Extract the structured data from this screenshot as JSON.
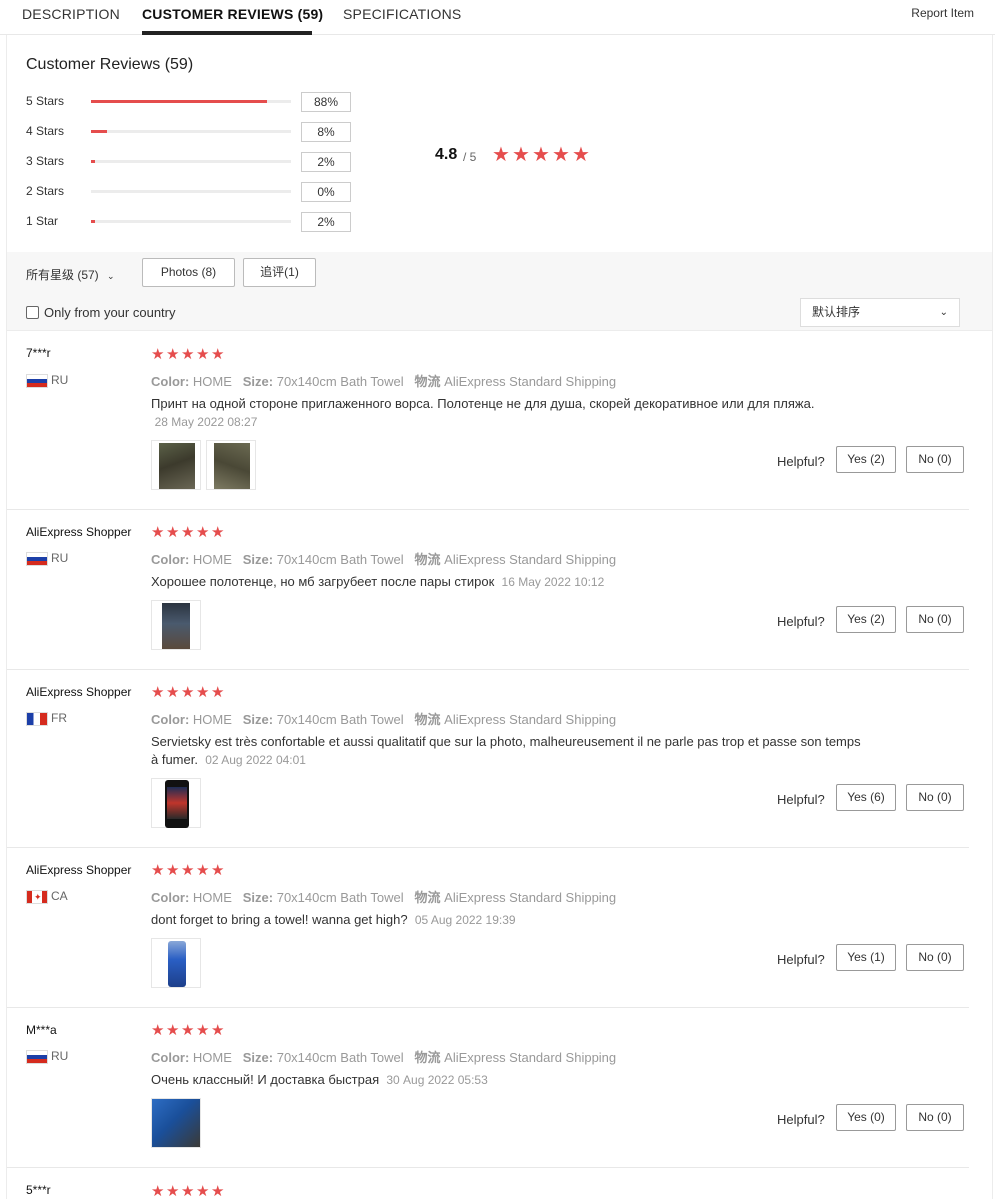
{
  "tabs": [
    {
      "label": "DESCRIPTION"
    },
    {
      "label": "CUSTOMER REVIEWS (59)",
      "active": true
    },
    {
      "label": "SPECIFICATIONS"
    }
  ],
  "report_item": "Report Item",
  "summary": {
    "title": "Customer Reviews (59)",
    "distribution": [
      {
        "label": "5 Stars",
        "percent": 88,
        "percent_label": "88%"
      },
      {
        "label": "4 Stars",
        "percent": 8,
        "percent_label": "8%"
      },
      {
        "label": "3 Stars",
        "percent": 2,
        "percent_label": "2%"
      },
      {
        "label": "2 Stars",
        "percent": 0,
        "percent_label": "0%"
      },
      {
        "label": "1 Star",
        "percent": 2,
        "percent_label": "2%"
      }
    ],
    "average": "4.8",
    "average_of": "/ 5",
    "average_stars": 5
  },
  "filters": {
    "all_stars": "所有星级 (57)",
    "photos": "Photos (8)",
    "followup": "追评(1)",
    "only_country": "Only from your country",
    "sort": "默认排序"
  },
  "colors": {
    "accent": "#e54d4d"
  },
  "reviews": [
    {
      "user": "7***r",
      "country": "RU",
      "stars": 5,
      "color_label": "Color:",
      "color": "HOME",
      "size_label": "Size:",
      "size": "70x140cm Bath Towel",
      "ship_label": "物流",
      "shipping": "AliExpress Standard Shipping",
      "text": "Принт на одной стороне приглаженного ворса. Полотенце не для душа, скорей декоративное или для пляжа.",
      "date": "28 May 2022 08:27",
      "helpful": "Helpful?",
      "yes": "Yes (2)",
      "no": "No (0)"
    },
    {
      "user": "AliExpress Shopper",
      "country": "RU",
      "stars": 5,
      "color_label": "Color:",
      "color": "HOME",
      "size_label": "Size:",
      "size": "70x140cm Bath Towel",
      "ship_label": "物流",
      "shipping": "AliExpress Standard Shipping",
      "text": "Хорошее полотенце, но мб загрубеет после пары стирок",
      "date": "16 May 2022 10:12",
      "helpful": "Helpful?",
      "yes": "Yes (2)",
      "no": "No (0)"
    },
    {
      "user": "AliExpress Shopper",
      "country": "FR",
      "stars": 5,
      "color_label": "Color:",
      "color": "HOME",
      "size_label": "Size:",
      "size": "70x140cm Bath Towel",
      "ship_label": "物流",
      "shipping": "AliExpress Standard Shipping",
      "text": "Servietsky est très confortable et aussi qualitatif que sur la photo, malheureusement il ne parle pas trop et passe son temps à fumer.",
      "date": "02 Aug 2022 04:01",
      "helpful": "Helpful?",
      "yes": "Yes (6)",
      "no": "No (0)"
    },
    {
      "user": "AliExpress Shopper",
      "country": "CA",
      "stars": 5,
      "color_label": "Color:",
      "color": "HOME",
      "size_label": "Size:",
      "size": "70x140cm Bath Towel",
      "ship_label": "物流",
      "shipping": "AliExpress Standard Shipping",
      "text": "dont forget to bring a towel! wanna get high?",
      "date": "05 Aug 2022 19:39",
      "helpful": "Helpful?",
      "yes": "Yes (1)",
      "no": "No (0)"
    },
    {
      "user": "M***a",
      "country": "RU",
      "stars": 5,
      "color_label": "Color:",
      "color": "HOME",
      "size_label": "Size:",
      "size": "70x140cm Bath Towel",
      "ship_label": "物流",
      "shipping": "AliExpress Standard Shipping",
      "text": "Очень классный! И доставка быстрая",
      "date": "30 Aug 2022 05:53",
      "helpful": "Helpful?",
      "yes": "Yes (0)",
      "no": "No (0)"
    },
    {
      "user": "5***r",
      "stars": 5
    }
  ]
}
